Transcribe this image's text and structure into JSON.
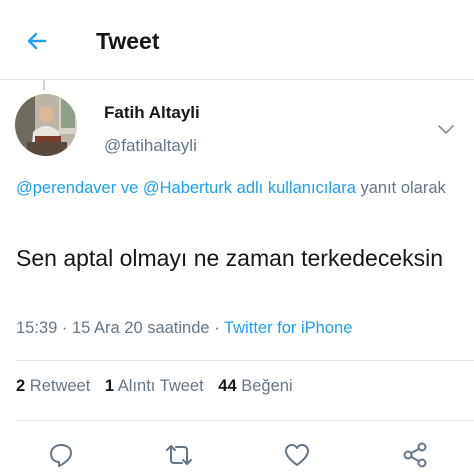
{
  "header": {
    "title": "Tweet",
    "back_icon": "arrow-left-icon",
    "accent_color": "#1da1f2"
  },
  "tweet": {
    "author": {
      "name": "Fatih Altayli",
      "handle": "@fatihaltayli"
    },
    "reply_context": {
      "mention_1": "@perendaver",
      "connector": "ve",
      "mention_2": "@Haberturk",
      "suffix": "adlı kullanıcılara",
      "text": "yanıt olarak"
    },
    "text": "Sen aptal olmayı ne zaman terkedeceksin",
    "meta": {
      "time": "15:39",
      "separator": "·",
      "date": "15 Ara 20 saatinde",
      "source": "Twitter for iPhone"
    },
    "stats": {
      "retweets_count": "2",
      "retweets_label": "Retweet",
      "quotes_count": "1",
      "quotes_label": "Alıntı Tweet",
      "likes_count": "44",
      "likes_label": "Beğeni"
    }
  },
  "actions": {
    "icons": [
      "reply-icon",
      "retweet-icon",
      "like-icon",
      "share-icon"
    ]
  },
  "colors": {
    "text_primary": "#14171a",
    "text_secondary": "#657786",
    "link": "#1da1f2",
    "divider": "#e1e8ed"
  }
}
